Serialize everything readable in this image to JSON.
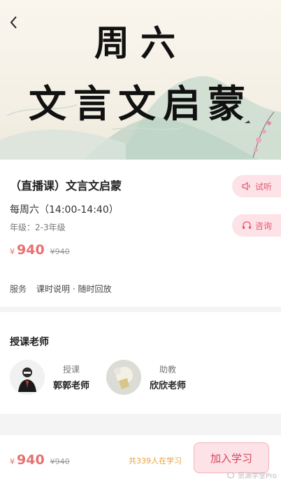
{
  "banner": {
    "title_line1": "周六",
    "title_line2": "文言文启蒙"
  },
  "course": {
    "title": "（直播课）文言文启蒙",
    "schedule": "每周六（14:00-14:40）",
    "grade": "年级：2-3年级",
    "currency": "¥",
    "price": "940",
    "original_price": "¥940",
    "listen_label": "试听",
    "consult_label": "咨询"
  },
  "service": {
    "label": "服务",
    "value": "课时说明 · 随时回放"
  },
  "teachers": {
    "heading": "授课老师",
    "items": [
      {
        "role": "授课",
        "name": "郭郭老师"
      },
      {
        "role": "助教",
        "name": "欣欣老师"
      }
    ]
  },
  "bottom": {
    "currency": "¥",
    "price": "940",
    "original_price": "¥940",
    "learners": "共339人在学习",
    "join_label": "加入学习"
  },
  "watermark": "思源学堂Pro",
  "colors": {
    "accent": "#e8706e",
    "pill_bg": "#fde3e7",
    "learners": "#e8a23a"
  }
}
